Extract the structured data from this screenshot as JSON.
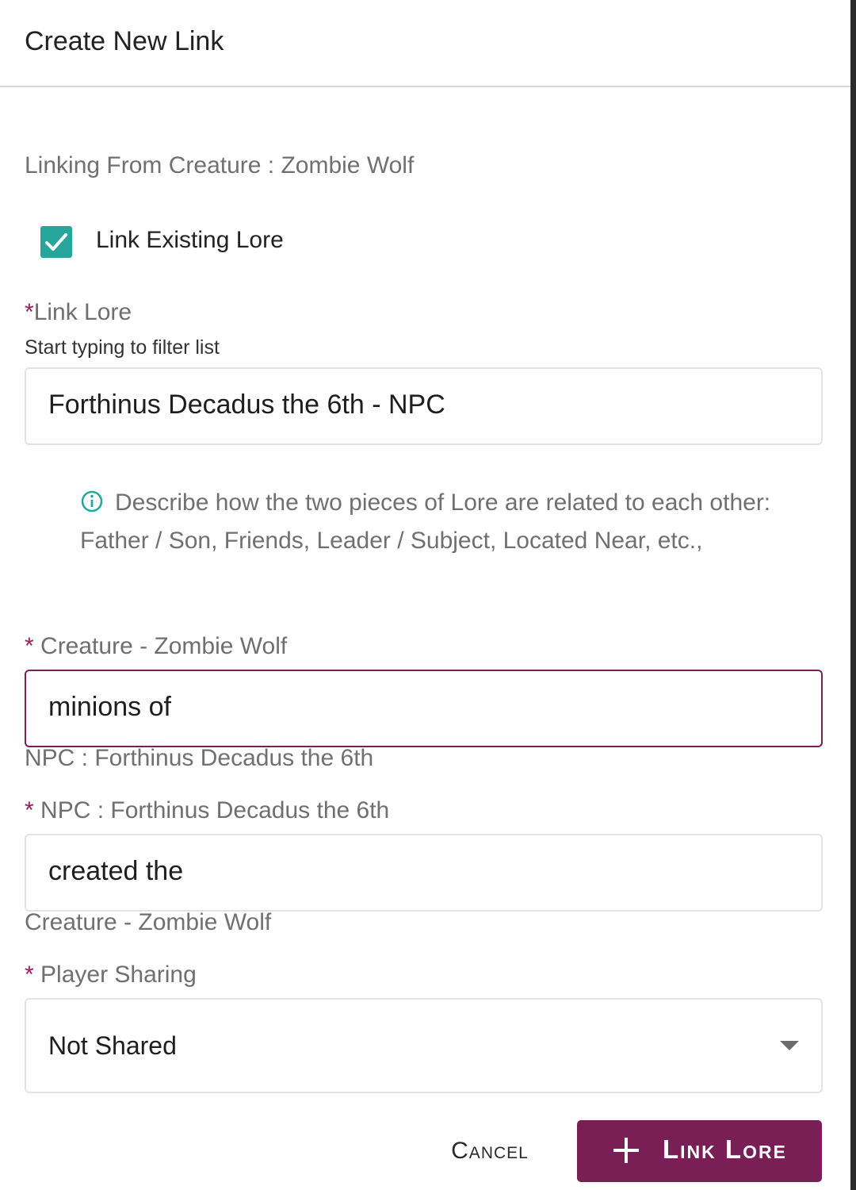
{
  "dialog": {
    "title": "Create New Link",
    "linking_from": "Linking From Creature : Zombie Wolf"
  },
  "link_existing": {
    "label": "Link Existing Lore",
    "checked": true,
    "checkbox_color": "#26a69a"
  },
  "link_lore": {
    "required_mark": "*",
    "label": "Link Lore",
    "hint": "Start typing to filter list",
    "value": "Forthinus Decadus the 6th - NPC"
  },
  "info": {
    "icon": "info-circle-icon",
    "text": "Describe how the two pieces of Lore are related to each other: Father / Son, Friends, Leader / Subject, Located Near, etc.,"
  },
  "relation_1": {
    "required_mark": "*",
    "label": "Creature - Zombie Wolf",
    "value": "minions of",
    "target": "NPC : Forthinus Decadus the 6th"
  },
  "relation_2": {
    "required_mark": "*",
    "label": "NPC : Forthinus Decadus the 6th",
    "value": "created the",
    "target": "Creature - Zombie Wolf"
  },
  "player_sharing": {
    "required_mark": "*",
    "label": "Player Sharing",
    "selected": "Not Shared"
  },
  "actions": {
    "cancel_label": "Cancel",
    "submit_label": "Link Lore",
    "submit_icon": "plus-icon"
  },
  "colors": {
    "accent": "#7a1f56",
    "required": "#9c1e5f",
    "checkbox": "#26a69a",
    "info_icon": "#26a69a"
  }
}
